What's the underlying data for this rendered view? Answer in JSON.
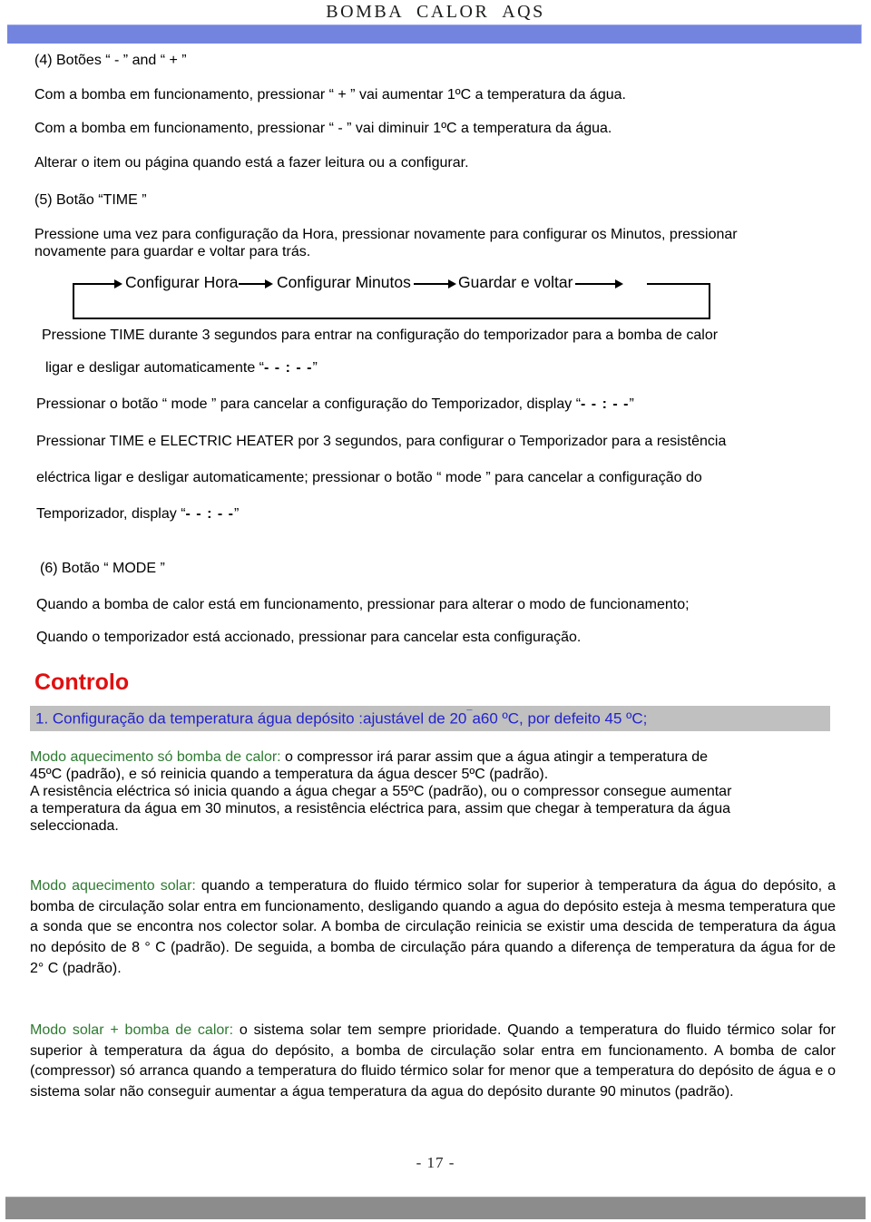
{
  "document": {
    "header_title": "BOMBA  CALOR  AQS",
    "page_number": "- 17 -",
    "accent_bar_color": "#7384DE",
    "footer_bar_color": "#8c8c8c"
  },
  "section4": {
    "title": "(4)  Botões “ - ”   and     “ + ”",
    "lines": [
      "Com a bomba em funcionamento, pressionar “ + ” vai aumentar 1ºC a temperatura da água.",
      "Com a bomba em funcionamento, pressionar “ - ” vai diminuir 1ºC a temperatura da água.",
      "Alterar o item ou página quando está a fazer leitura ou a configurar."
    ]
  },
  "section5": {
    "title": "(5) Botão “TIME ”",
    "intro": "Pressione uma vez para configuração da Hora, pressionar novamente para configurar os Minutos, pressionar novamente para guardar e voltar para trás.",
    "flow": {
      "steps": [
        "Configurar Hora",
        "Configurar Minutos",
        "Guardar e voltar"
      ],
      "loop": true
    },
    "paragraphs": [
      {
        "text_before": "Pressione TIME durante 3 segundos para entrar na configuração do temporizador para a bomba de calor",
        "text_after": "",
        "display": ""
      },
      {
        "text_before": "ligar e desligar automaticamente “",
        "display": "- - : - -",
        "text_after": "”"
      },
      {
        "text_before": "Pressionar o botão “ mode ” para cancelar a configuração do Temporizador, display “",
        "display": "- - : - -",
        "text_after": "”"
      },
      {
        "text_before": "Pressionar TIME e ELECTRIC HEATER por 3 segundos, para configurar o Temporizador para a resistência",
        "display": "",
        "text_after": ""
      },
      {
        "text_before": "eléctrica ligar e desligar automaticamente; pressionar o botão “ mode ” para cancelar a configuração do",
        "display": "",
        "text_after": ""
      },
      {
        "text_before": "Temporizador, display “",
        "display": "- - : - -",
        "text_after": "”"
      }
    ]
  },
  "section6": {
    "title": "(6) Botão “ MODE ”",
    "lines": [
      "Quando a bomba de calor está em funcionamento, pressionar para alterar o modo de funcionamento;",
      "Quando o temporizador está accionado, pressionar para cancelar esta configuração."
    ]
  },
  "controlo": {
    "heading": "Controlo",
    "heading_color": "#E01010",
    "highlight_color": "#c0c0c0",
    "item1": {
      "text_before": "1. Configuração da temperatura água depósito :ajustável de 20",
      "mark": "¯",
      "text_after": "a60 ºC, por defeito 45 ºC;",
      "color": "#2222D0"
    },
    "modes": [
      {
        "label": "Modo aquecimento só bomba de calor:",
        "label_color": "#2E7A31",
        "body_lines": [
          " o compressor irá parar assim que a água atingir a temperatura de",
          "45ºC (padrão), e só reinicia quando a temperatura da água descer 5ºC (padrão).",
          "A resistência eléctrica só inicia quando a água chegar a 55ºC (padrão), ou o compressor consegue aumentar",
          "a temperatura da água em 30 minutos, a resistência eléctrica para, assim que chegar à temperatura da água",
          "seleccionada."
        ]
      },
      {
        "label": "Modo aquecimento solar:",
        "label_color": "#2E7A31",
        "body": " quando a temperatura do fluido térmico solar for superior à temperatura da água do depósito, a bomba de circulação solar entra em funcionamento, desligando quando a agua do depósito esteja à mesma temperatura que a sonda que se encontra nos colector solar. A bomba de circulação reinicia se existir uma descida de temperatura da água no depósito de 8 ° C (padrão). De seguida, a bomba de circulação pára quando a diferença de temperatura da água for de 2° C (padrão)."
      },
      {
        "label": "Modo solar + bomba de calor:",
        "label_color": "#2E7A31",
        "body": " o sistema solar tem sempre prioridade. Quando a temperatura do fluido térmico solar for superior à temperatura da água do depósito, a bomba de circulação solar entra em funcionamento. A bomba de calor (compressor) só arranca quando a temperatura do fluido térmico solar for menor que a temperatura do depósito de água e o sistema solar não conseguir aumentar a água temperatura da agua do depósito durante 90 minutos (padrão)."
      }
    ]
  }
}
